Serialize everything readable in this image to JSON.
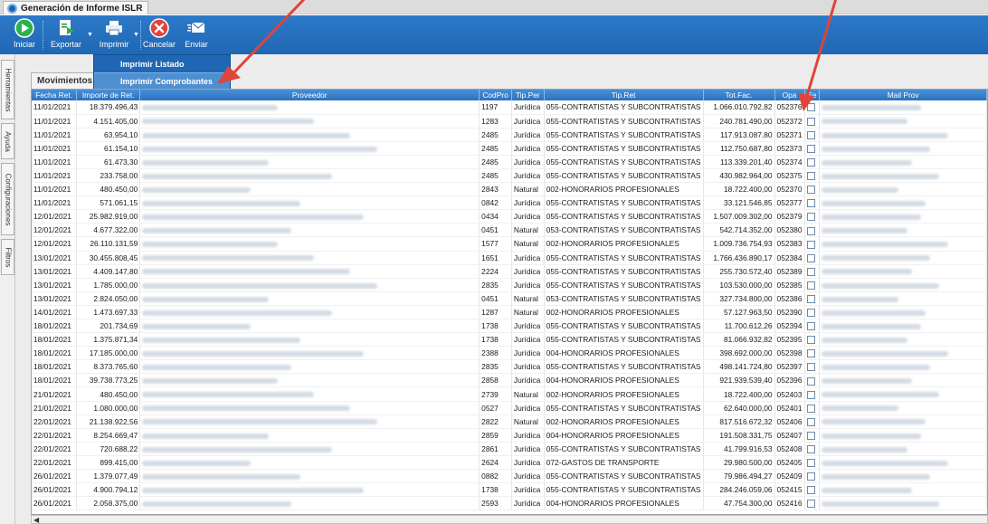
{
  "window": {
    "title": "Generación de Informe ISLR"
  },
  "toolbar": {
    "iniciar": "Iniciar",
    "exportar": "Exportar",
    "imprimir": "Imprimir",
    "cancelar": "Cancelar",
    "enviar": "Enviar"
  },
  "print_menu": {
    "listado": "Imprimir Listado",
    "comprobantes": "Imprimir Comprobantes"
  },
  "sidebar": {
    "tabs": [
      "Herramientas",
      "Ayuda",
      "Configuraciones",
      "Filtros"
    ]
  },
  "tab_movimientos": "Movimientos",
  "table": {
    "columns": [
      "Fecha Ret.",
      "Importe de Ret.",
      "Proveedor",
      "CodPro",
      "Tip.Per",
      "Tip.Ret",
      "Tot.Fac.",
      "Opa",
      "Se",
      "Mail Prov"
    ],
    "rows": [
      [
        "11/01/2021",
        "18.379.496,43",
        "",
        "1197",
        "Jurídica",
        "055-CONTRATISTAS Y SUBCONTRATISTAS",
        "1.066.010.792,82",
        "052376",
        "",
        ""
      ],
      [
        "11/01/2021",
        "4.151.405,00",
        "",
        "1283",
        "Jurídica",
        "055-CONTRATISTAS Y SUBCONTRATISTAS",
        "240.781.490,00",
        "052372",
        "",
        ""
      ],
      [
        "11/01/2021",
        "63.954,10",
        "",
        "2485",
        "Jurídica",
        "055-CONTRATISTAS Y SUBCONTRATISTAS",
        "117.913.087,80",
        "052371",
        "",
        ""
      ],
      [
        "11/01/2021",
        "61.154,10",
        "",
        "2485",
        "Jurídica",
        "055-CONTRATISTAS Y SUBCONTRATISTAS",
        "112.750.687,80",
        "052373",
        "",
        ""
      ],
      [
        "11/01/2021",
        "61.473,30",
        "",
        "2485",
        "Jurídica",
        "055-CONTRATISTAS Y SUBCONTRATISTAS",
        "113.339.201,40",
        "052374",
        "",
        ""
      ],
      [
        "11/01/2021",
        "233.758,00",
        "",
        "2485",
        "Jurídica",
        "055-CONTRATISTAS Y SUBCONTRATISTAS",
        "430.982.964,00",
        "052375",
        "",
        ""
      ],
      [
        "11/01/2021",
        "480.450,00",
        "",
        "2843",
        "Natural",
        "002-HONORARIOS PROFESIONALES",
        "18.722.400,00",
        "052370",
        "",
        ""
      ],
      [
        "11/01/2021",
        "571.061,15",
        "",
        "0842",
        "Jurídica",
        "055-CONTRATISTAS Y SUBCONTRATISTAS",
        "33.121.546,85",
        "052377",
        "",
        ""
      ],
      [
        "12/01/2021",
        "25.982.919,00",
        "",
        "0434",
        "Jurídica",
        "055-CONTRATISTAS Y SUBCONTRATISTAS",
        "1.507.009.302,00",
        "052379",
        "",
        ""
      ],
      [
        "12/01/2021",
        "4.677.322,00",
        "",
        "0451",
        "Natural",
        "053-CONTRATISTAS Y SUBCONTRATISTAS",
        "542.714.352,00",
        "052380",
        "",
        ""
      ],
      [
        "12/01/2021",
        "26.110.131,59",
        "",
        "1577",
        "Natural",
        "002-HONORARIOS PROFESIONALES",
        "1.009.736.754,93",
        "052383",
        "",
        ""
      ],
      [
        "13/01/2021",
        "30.455.808,45",
        "",
        "1651",
        "Jurídica",
        "055-CONTRATISTAS Y SUBCONTRATISTAS",
        "1.766.436.890,17",
        "052384",
        "",
        ""
      ],
      [
        "13/01/2021",
        "4.409.147,80",
        "",
        "2224",
        "Jurídica",
        "055-CONTRATISTAS Y SUBCONTRATISTAS",
        "255.730.572,40",
        "052389",
        "",
        ""
      ],
      [
        "13/01/2021",
        "1.785.000,00",
        "",
        "2835",
        "Jurídica",
        "055-CONTRATISTAS Y SUBCONTRATISTAS",
        "103.530.000,00",
        "052385",
        "",
        ""
      ],
      [
        "13/01/2021",
        "2.824.050,00",
        "",
        "0451",
        "Natural",
        "053-CONTRATISTAS Y SUBCONTRATISTAS",
        "327.734.800,00",
        "052386",
        "",
        ""
      ],
      [
        "14/01/2021",
        "1.473.697,33",
        "",
        "1287",
        "Natural",
        "002-HONORARIOS PROFESIONALES",
        "57.127.963,50",
        "052390",
        "",
        ""
      ],
      [
        "18/01/2021",
        "201.734,69",
        "",
        "1738",
        "Jurídica",
        "055-CONTRATISTAS Y SUBCONTRATISTAS",
        "11.700.612,26",
        "052394",
        "",
        ""
      ],
      [
        "18/01/2021",
        "1.375.871,34",
        "",
        "1738",
        "Jurídica",
        "055-CONTRATISTAS Y SUBCONTRATISTAS",
        "81.066.932,82",
        "052395",
        "",
        ""
      ],
      [
        "18/01/2021",
        "17.185.000,00",
        "",
        "2388",
        "Jurídica",
        "004-HONORARIOS PROFESIONALES",
        "398.692.000,00",
        "052398",
        "",
        ""
      ],
      [
        "18/01/2021",
        "8.373.765,60",
        "",
        "2835",
        "Jurídica",
        "055-CONTRATISTAS Y SUBCONTRATISTAS",
        "498.141.724,80",
        "052397",
        "",
        ""
      ],
      [
        "18/01/2021",
        "39.738.773,25",
        "",
        "2858",
        "Jurídica",
        "004-HONORARIOS PROFESIONALES",
        "921.939.539,40",
        "052396",
        "",
        ""
      ],
      [
        "21/01/2021",
        "480.450,00",
        "",
        "2739",
        "Natural",
        "002-HONORARIOS PROFESIONALES",
        "18.722.400,00",
        "052403",
        "",
        ""
      ],
      [
        "21/01/2021",
        "1.080.000,00",
        "",
        "0527",
        "Jurídica",
        "055-CONTRATISTAS Y SUBCONTRATISTAS",
        "62.640.000,00",
        "052401",
        "",
        ""
      ],
      [
        "22/01/2021",
        "21.138.922,56",
        "",
        "2822",
        "Natural",
        "002-HONORARIOS PROFESIONALES",
        "817.516.672,32",
        "052406",
        "",
        ""
      ],
      [
        "22/01/2021",
        "8.254.669,47",
        "",
        "2859",
        "Jurídica",
        "004-HONORARIOS PROFESIONALES",
        "191.508.331,75",
        "052407",
        "",
        ""
      ],
      [
        "22/01/2021",
        "720.688,22",
        "",
        "2861",
        "Jurídica",
        "055-CONTRATISTAS Y SUBCONTRATISTAS",
        "41.799.916,53",
        "052408",
        "",
        ""
      ],
      [
        "22/01/2021",
        "899.415,00",
        "",
        "2624",
        "Jurídica",
        "072-GASTOS DE TRANSPORTE",
        "29.980.500,00",
        "052405",
        "",
        ""
      ],
      [
        "26/01/2021",
        "1.379.077,49",
        "",
        "0882",
        "Jurídica",
        "055-CONTRATISTAS Y SUBCONTRATISTAS",
        "79.986.494,27",
        "052409",
        "",
        ""
      ],
      [
        "26/01/2021",
        "4.900.794,12",
        "",
        "1738",
        "Jurídica",
        "055-CONTRATISTAS Y SUBCONTRATISTAS",
        "284.246.059,06",
        "052415",
        "",
        ""
      ],
      [
        "26/01/2021",
        "2.058.375,00",
        "",
        "2593",
        "Jurídica",
        "004-HONORARIOS PROFESIONALES",
        "47.754.300,00",
        "052416",
        "",
        ""
      ]
    ]
  },
  "colors": {
    "ribbon": "#1f67b4",
    "header": "#2a72bf",
    "annotation_arrow": "#e0443a"
  }
}
